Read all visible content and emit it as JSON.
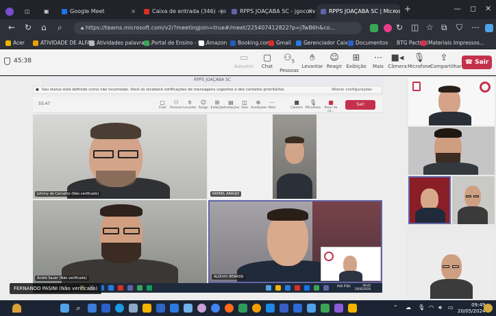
{
  "browser": {
    "tabs": [
      {
        "label": "Google Meet",
        "color": "#1a73e8"
      },
      {
        "label": "Caixa de entrada (346) - johnny...",
        "color": "#d93025"
      },
      {
        "label": "RPPS JOAÇABA SC - jgocoliv@g...",
        "color": "#6264a7"
      },
      {
        "label": "RPPS JOAÇABA SC | Microso...",
        "color": "#6264a7"
      }
    ],
    "url": "https://teams.microsoft.com/v2/?meetingjoin=true#/meet/22540741282​2?p=jTwB6h&co...",
    "bookmarks": [
      {
        "label": "Acer",
        "color": "#f0b400"
      },
      {
        "label": "ATIVIDADE DE ALFA...",
        "color": "#e8a200"
      },
      {
        "label": "Atividades palavras...",
        "color": "#bbbbbb"
      },
      {
        "label": "Portal de Ensino - U...",
        "color": "#3aa655"
      },
      {
        "label": "Amazon",
        "color": "#ffffff"
      },
      {
        "label": "Booking.com",
        "color": "#1f5fbf"
      },
      {
        "label": "Gmail",
        "color": "#d93025"
      },
      {
        "label": "Gerenciador Caixa",
        "color": "#2a7be0"
      },
      {
        "label": "Documentos",
        "color": "#2a62c8"
      },
      {
        "label": "BTG Pactual",
        "color": "#222"
      },
      {
        "label": "Materiais Impressos...",
        "color": "#d9304a"
      }
    ]
  },
  "meeting": {
    "timer": "45:38",
    "controls": [
      {
        "label": "Assumir",
        "glyph": "▭",
        "dim": true
      },
      {
        "label": "Chat",
        "glyph": "☺",
        "dim": false
      },
      {
        "label": "Pessoas",
        "glyph": "⚇",
        "dim": false
      },
      {
        "label": "Levantar",
        "glyph": "✋",
        "dim": false
      },
      {
        "label": "Reagir",
        "glyph": "☺",
        "dim": false
      },
      {
        "label": "Exibição",
        "glyph": "⊞",
        "dim": false
      },
      {
        "label": "Mais",
        "glyph": "⋯",
        "dim": false
      },
      {
        "label": "Câmera",
        "glyph": "■",
        "dim": false
      },
      {
        "label": "Microfone",
        "glyph": "🎙",
        "dim": false
      },
      {
        "label": "Compartilhar",
        "glyph": "⇪",
        "dim": false
      }
    ],
    "people_count": "5",
    "leave_label": "Sair"
  },
  "shared_screen": {
    "title": "RPPS JOAÇABA SC",
    "notice": "Seu status está definido como não incomodar. Você só receberá notificações de mensagens urgentes e dos contatos prioritários.",
    "notice_button": "Alterar configurações",
    "timer": "55:47",
    "leave_label": "Sair",
    "controls": [
      "Chat",
      "Pessoas",
      "Levantar",
      "Reagir",
      "Exibição",
      "Anotações",
      "Sala",
      "Anotações",
      "Mais",
      "Câmera",
      "Microfone",
      "Parar de co..."
    ],
    "tiles": [
      {
        "name": "Johnny de Carvalho (Não verificado)"
      },
      {
        "name": "RAFAEL ARAUJO"
      },
      {
        "name": "André Sauer (Não verificado)"
      },
      {
        "name": "ALDIVIO BENASSI"
      }
    ],
    "inner_clock": "09:45",
    "inner_date": "20/05/2024",
    "inner_lang": "POR PTB2"
  },
  "presenter_banner": "FERNANDO PASINI (Não verificado)",
  "taskbar": {
    "time": "09:49",
    "date": "20/05/2024"
  }
}
